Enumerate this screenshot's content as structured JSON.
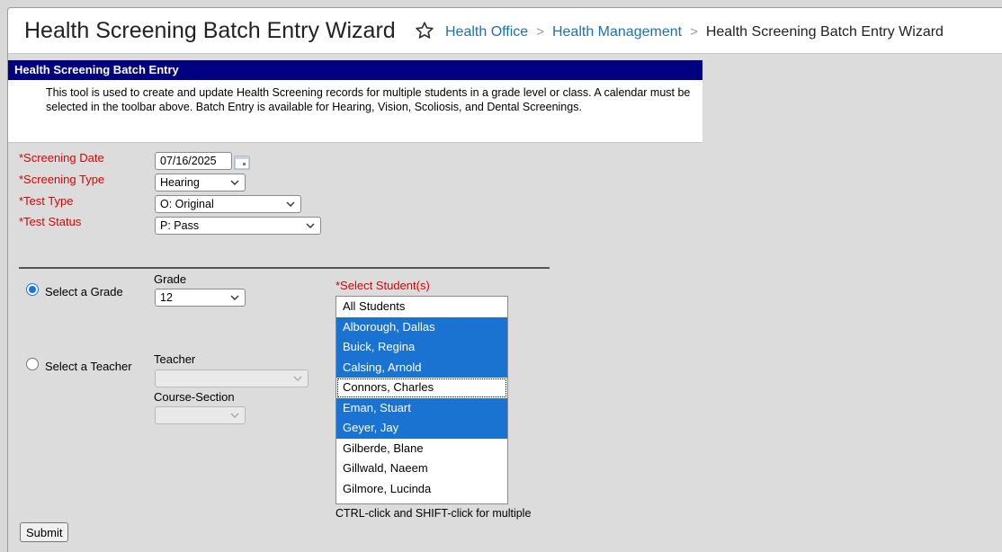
{
  "header": {
    "title": "Health Screening Batch Entry Wizard",
    "breadcrumbs": [
      "Health Office",
      "Health Management"
    ],
    "breadcrumb_current": "Health Screening Batch Entry Wizard"
  },
  "panel": {
    "title": "Health Screening Batch Entry",
    "description": "This tool is used to create and update Health Screening records for multiple students in a grade level or class. A calendar must be selected in the toolbar above. Batch Entry is available for Hearing, Vision, Scoliosis, and Dental Screenings."
  },
  "form": {
    "screening_date_label": "*Screening Date",
    "screening_date_value": "07/16/2025",
    "screening_type_label": "*Screening Type",
    "screening_type_value": "Hearing",
    "test_type_label": "*Test Type",
    "test_type_value": "O: Original",
    "test_status_label": "*Test Status",
    "test_status_value": "P: Pass"
  },
  "selection": {
    "grade_radio_label": "Select a Grade",
    "teacher_radio_label": "Select a Teacher",
    "grade_selected": true,
    "grade_label": "Grade",
    "grade_value": "12",
    "teacher_label": "Teacher",
    "teacher_value": "",
    "course_section_label": "Course-Section",
    "course_section_value": "",
    "students_label": "*Select Student(s)",
    "students": [
      {
        "name": "All Students",
        "selected": false
      },
      {
        "name": "Alborough, Dallas",
        "selected": true
      },
      {
        "name": "Buick, Regina",
        "selected": true
      },
      {
        "name": "Calsing, Arnold",
        "selected": true
      },
      {
        "name": "Connors, Charles",
        "selected": false,
        "focused": true
      },
      {
        "name": "Eman, Stuart",
        "selected": true
      },
      {
        "name": "Geyer, Jay",
        "selected": true
      },
      {
        "name": "Gilberde, Blane",
        "selected": false
      },
      {
        "name": "Gillwald, Naeem",
        "selected": false
      },
      {
        "name": "Gilmore, Lucinda",
        "selected": false
      }
    ],
    "hint": "CTRL-click and SHIFT-click for multiple"
  },
  "actions": {
    "submit_label": "Submit"
  },
  "colors": {
    "panel_header": "#000080",
    "selection": "#1a73d0",
    "required": "#e00000",
    "link": "#1f6fb3"
  }
}
